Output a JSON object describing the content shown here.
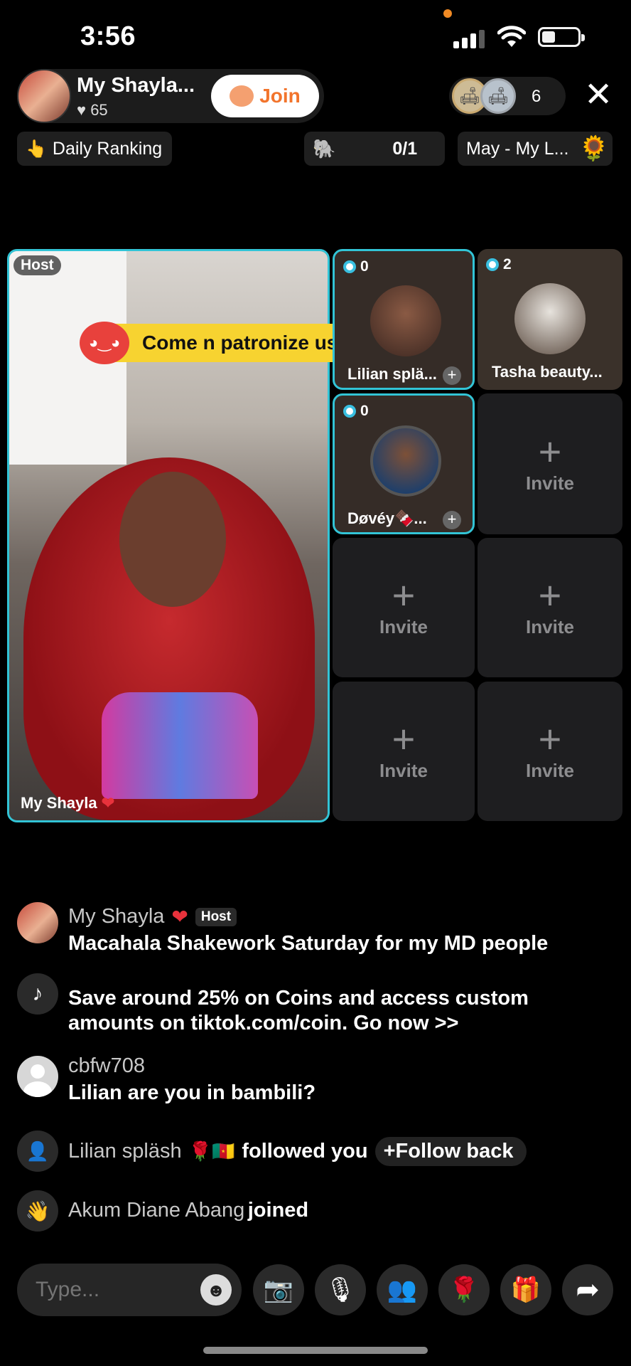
{
  "status": {
    "time": "3:56"
  },
  "header": {
    "host_name": "My Shayla...",
    "host_likes": "65",
    "join_label": "Join",
    "viewer_count": "6"
  },
  "subheader": {
    "daily_ranking": "Daily Ranking",
    "goal_progress": "0/1",
    "goal_title": "May - My L..."
  },
  "stage": {
    "host_badge": "Host",
    "host_label": "My Shayla",
    "pinned_message": "Come n patronize us  at DMV",
    "guests": [
      {
        "score": "0",
        "name": "Lilian splä..."
      },
      {
        "score": "2",
        "name": "Tasha beauty..."
      },
      {
        "score": "0",
        "name": "Døvéy🍫..."
      }
    ],
    "invite_label": "Invite"
  },
  "chat": [
    {
      "name": "My Shayla",
      "badge": "Host",
      "text": "Macahala Shakework Saturday for my MD people"
    },
    {
      "text_line1": "Save around 25% on Coins and access custom",
      "text_line2": "amounts on tiktok.com/coin. Go now >>"
    },
    {
      "name": "cbfw708",
      "text": "Lilian are you in bambili?"
    },
    {
      "name": "Lilian spläsh",
      "flags": "🌹🇨🇲",
      "action": "followed you",
      "button": "Follow back"
    },
    {
      "name": "Akum Diane Abang",
      "action": "joined"
    }
  ],
  "composer": {
    "placeholder": "Type..."
  },
  "colors": {
    "accent": "#32c4d6",
    "join_text": "#f2742c",
    "pinned_bg": "#f7d330"
  }
}
